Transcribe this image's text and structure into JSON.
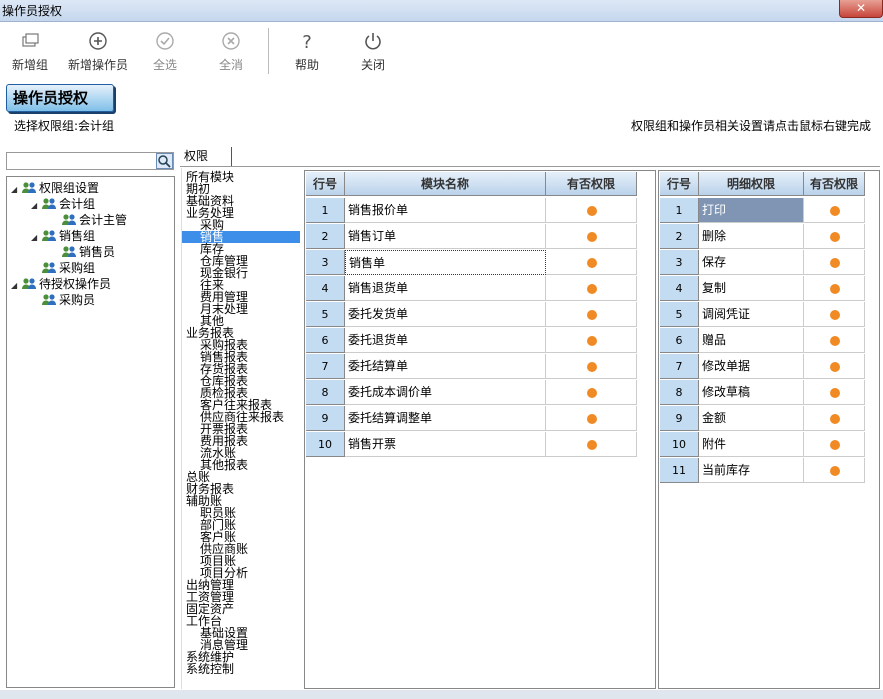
{
  "window": {
    "title": "操作员授权",
    "close_glyph": "✕"
  },
  "toolbar": {
    "new_group": "新增组",
    "new_operator": "新增操作员",
    "select_all": "全选",
    "deselect_all": "全消",
    "help": "帮助",
    "close": "关闭"
  },
  "header": {
    "title": "操作员授权",
    "selected_group": "选择权限组:会计组",
    "hint": "权限组和操作员相关设置请点击鼠标右键完成"
  },
  "tabs": {
    "permissions": "权限"
  },
  "tree": [
    {
      "label": "权限组设置",
      "depth": 0,
      "expanded": true
    },
    {
      "label": "会计组",
      "depth": 1,
      "expanded": true
    },
    {
      "label": "会计主管",
      "depth": 2
    },
    {
      "label": "销售组",
      "depth": 1,
      "expanded": true
    },
    {
      "label": "销售员",
      "depth": 2
    },
    {
      "label": "采购组",
      "depth": 1
    },
    {
      "label": "待授权操作员",
      "depth": 0,
      "expanded": true
    },
    {
      "label": "采购员",
      "depth": 1
    }
  ],
  "modules": [
    {
      "label": "所有模块",
      "indent": 0
    },
    {
      "label": "期初",
      "indent": 0
    },
    {
      "label": "基础资料",
      "indent": 0
    },
    {
      "label": "业务处理",
      "indent": 0
    },
    {
      "label": "采购",
      "indent": 1
    },
    {
      "label": "销售",
      "indent": 1,
      "selected": true
    },
    {
      "label": "库存",
      "indent": 1
    },
    {
      "label": "仓库管理",
      "indent": 1
    },
    {
      "label": "现金银行",
      "indent": 1
    },
    {
      "label": "往来",
      "indent": 1
    },
    {
      "label": "费用管理",
      "indent": 1
    },
    {
      "label": "月末处理",
      "indent": 1
    },
    {
      "label": "其他",
      "indent": 1
    },
    {
      "label": "业务报表",
      "indent": 0
    },
    {
      "label": "采购报表",
      "indent": 1
    },
    {
      "label": "销售报表",
      "indent": 1
    },
    {
      "label": "存货报表",
      "indent": 1
    },
    {
      "label": "仓库报表",
      "indent": 1
    },
    {
      "label": "质检报表",
      "indent": 1
    },
    {
      "label": "客户往来报表",
      "indent": 1
    },
    {
      "label": "供应商往来报表",
      "indent": 1
    },
    {
      "label": "开票报表",
      "indent": 1
    },
    {
      "label": "费用报表",
      "indent": 1
    },
    {
      "label": "流水账",
      "indent": 1
    },
    {
      "label": "其他报表",
      "indent": 1
    },
    {
      "label": "总账",
      "indent": 0
    },
    {
      "label": "财务报表",
      "indent": 0
    },
    {
      "label": "辅助账",
      "indent": 0
    },
    {
      "label": "职员账",
      "indent": 1
    },
    {
      "label": "部门账",
      "indent": 1
    },
    {
      "label": "客户账",
      "indent": 1
    },
    {
      "label": "供应商账",
      "indent": 1
    },
    {
      "label": "项目账",
      "indent": 1
    },
    {
      "label": "项目分析",
      "indent": 1
    },
    {
      "label": "出纳管理",
      "indent": 0
    },
    {
      "label": "工资管理",
      "indent": 0
    },
    {
      "label": "固定资产",
      "indent": 0
    },
    {
      "label": "工作台",
      "indent": 0
    },
    {
      "label": "基础设置",
      "indent": 1
    },
    {
      "label": "消息管理",
      "indent": 1
    },
    {
      "label": "系统维护",
      "indent": 0
    },
    {
      "label": "系统控制",
      "indent": 0
    }
  ],
  "module_grid": {
    "headers": {
      "row": "行号",
      "name": "模块名称",
      "perm": "有否权限"
    },
    "rows": [
      {
        "no": "1",
        "name": "销售报价单",
        "has": true
      },
      {
        "no": "2",
        "name": "销售订单",
        "has": true
      },
      {
        "no": "3",
        "name": "销售单",
        "has": true,
        "focused": true
      },
      {
        "no": "4",
        "name": "销售退货单",
        "has": true
      },
      {
        "no": "5",
        "name": "委托发货单",
        "has": true
      },
      {
        "no": "6",
        "name": "委托退货单",
        "has": true
      },
      {
        "no": "7",
        "name": "委托结算单",
        "has": true
      },
      {
        "no": "8",
        "name": "委托成本调价单",
        "has": true
      },
      {
        "no": "9",
        "name": "委托结算调整单",
        "has": true
      },
      {
        "no": "10",
        "name": "销售开票",
        "has": true
      }
    ]
  },
  "detail_grid": {
    "headers": {
      "row": "行号",
      "name": "明细权限",
      "perm": "有否权限"
    },
    "rows": [
      {
        "no": "1",
        "name": "打印",
        "has": true,
        "highlighted": true
      },
      {
        "no": "2",
        "name": "删除",
        "has": true
      },
      {
        "no": "3",
        "name": "保存",
        "has": true
      },
      {
        "no": "4",
        "name": "复制",
        "has": true
      },
      {
        "no": "5",
        "name": "调阅凭证",
        "has": true
      },
      {
        "no": "6",
        "name": "赠品",
        "has": true
      },
      {
        "no": "7",
        "name": "修改单据",
        "has": true
      },
      {
        "no": "8",
        "name": "修改草稿",
        "has": true
      },
      {
        "no": "9",
        "name": "金额",
        "has": true
      },
      {
        "no": "10",
        "name": "附件",
        "has": true
      },
      {
        "no": "11",
        "name": "当前库存",
        "has": true
      }
    ]
  },
  "colors": {
    "accent": "#3c8ee8",
    "dot": "#f08a24",
    "row_header": "#c4dcf2",
    "highlight": "#7f95b3"
  }
}
